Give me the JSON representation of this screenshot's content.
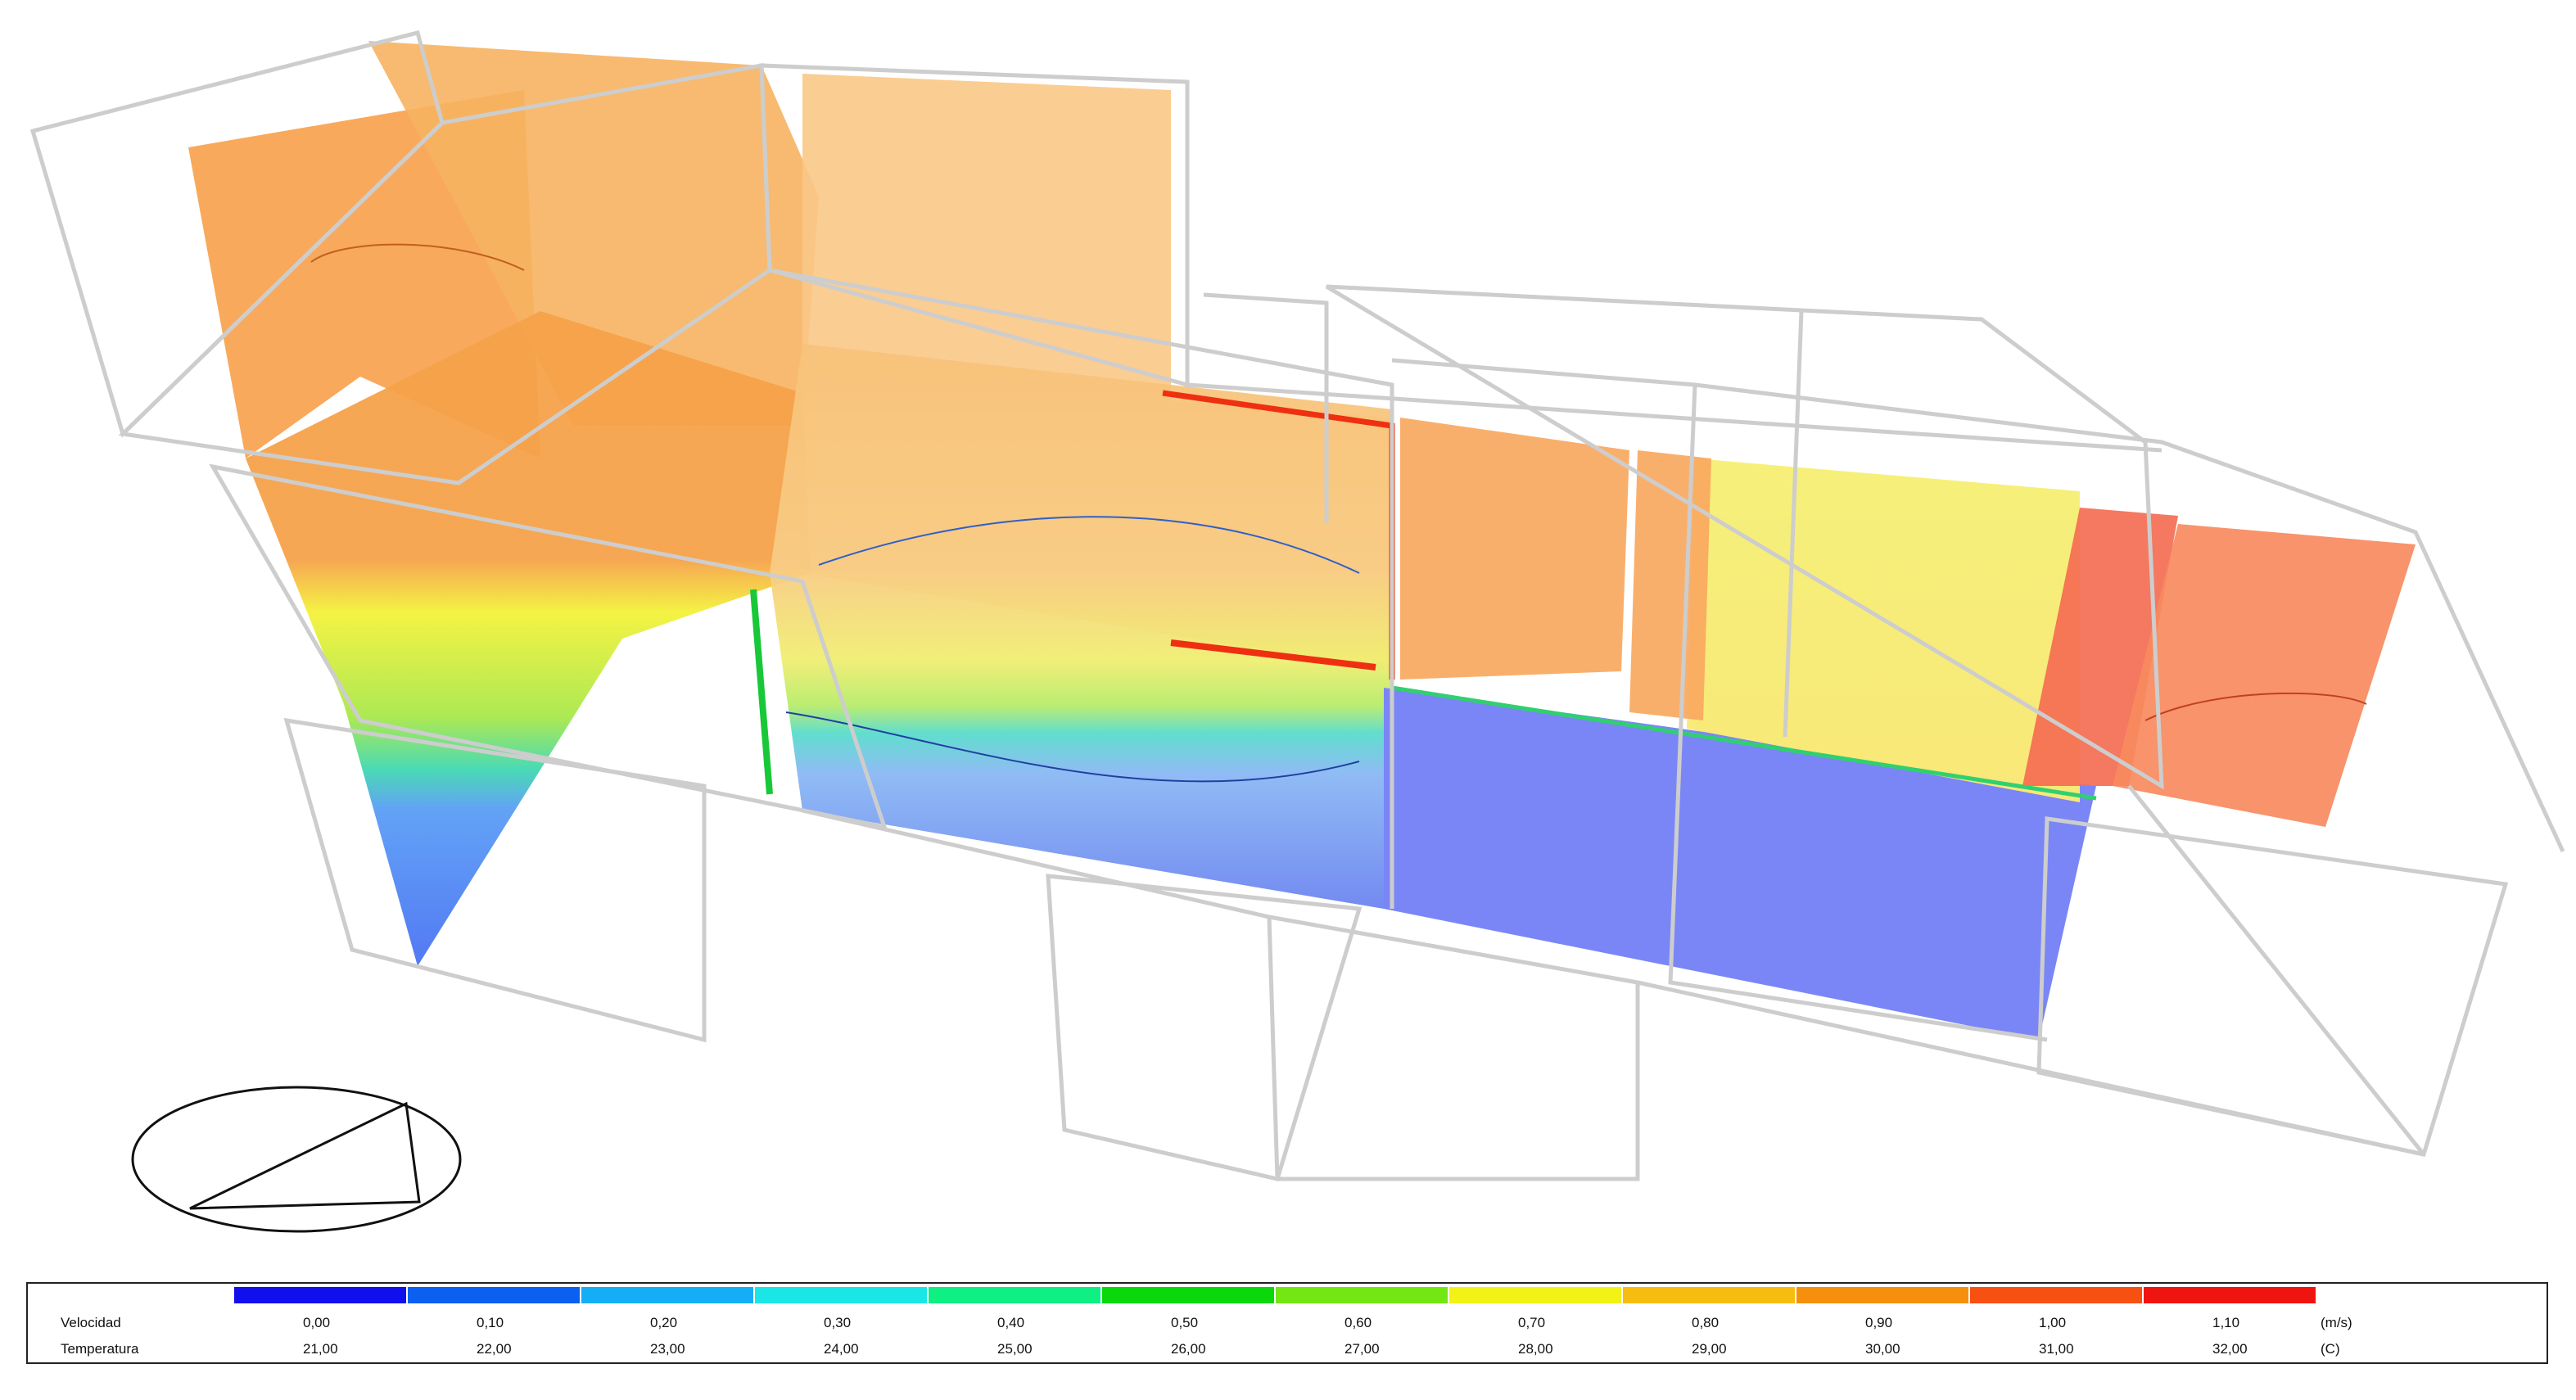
{
  "legend": {
    "rows": [
      {
        "label": "Velocidad",
        "unit": "(m/s)",
        "values": [
          "0,00",
          "0,10",
          "0,20",
          "0,30",
          "0,40",
          "0,50",
          "0,60",
          "0,70",
          "0,80",
          "0,90",
          "1,00",
          "1,10"
        ]
      },
      {
        "label": "Temperatura",
        "unit": "(C)",
        "values": [
          "21,00",
          "22,00",
          "23,00",
          "24,00",
          "25,00",
          "26,00",
          "27,00",
          "28,00",
          "29,00",
          "30,00",
          "31,00",
          "32,00"
        ]
      }
    ],
    "colors": [
      "#1010ee",
      "#0b60f0",
      "#14aef6",
      "#1ae6e6",
      "#0ef084",
      "#0ad80a",
      "#74e614",
      "#f2f214",
      "#f6bd10",
      "#f6900c",
      "#f65012",
      "#f01410"
    ]
  },
  "icons": {
    "orientation": "orientation-compass-icon"
  }
}
